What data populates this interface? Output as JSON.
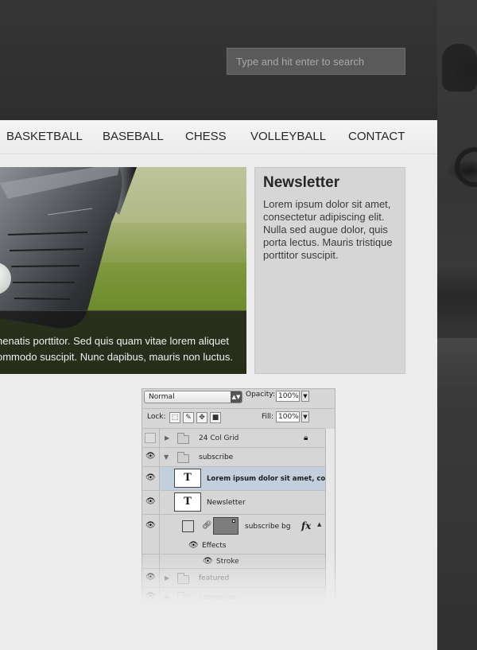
{
  "search": {
    "placeholder": "Type and hit enter to search"
  },
  "nav": {
    "items": [
      {
        "label": "BASKETBALL"
      },
      {
        "label": "BASEBALL"
      },
      {
        "label": "CHESS"
      },
      {
        "label": "VOLLEYBALL"
      },
      {
        "label": "CONTACT"
      }
    ]
  },
  "hero": {
    "caption_line1": "nenatis porttitor. Sed quis quam vitae lorem aliquet",
    "caption_line2": "ommodo suscipit. Nunc dapibus, mauris non luctus."
  },
  "newsletter": {
    "title": "Newsletter",
    "body": "Lorem ipsum dolor sit amet, consectetur adipiscing elit. Nulla sed augue dolor, quis porta lectus. Mauris tristique porttitor suscipit."
  },
  "layers_panel": {
    "blend_mode": "Normal",
    "opacity_label": "Opacity:",
    "opacity_value": "100%",
    "lock_label": "Lock:",
    "fill_label": "Fill:",
    "fill_value": "100%",
    "layers": [
      {
        "name": "24 Col Grid",
        "kind": "group",
        "visible": false,
        "locked": true
      },
      {
        "name": "subscribe",
        "kind": "group",
        "visible": true,
        "expanded": true
      },
      {
        "name": "Lorem ipsum dolor sit amet, con...",
        "kind": "text",
        "visible": true,
        "selected": true
      },
      {
        "name": "Newsletter",
        "kind": "text",
        "visible": true
      },
      {
        "name": "subscribe bg",
        "kind": "shape",
        "visible": true,
        "fx": "fx"
      },
      {
        "name": "Effects",
        "kind": "effects"
      },
      {
        "name": "Stroke",
        "kind": "effect"
      },
      {
        "name": "featured",
        "kind": "group",
        "visible": true
      },
      {
        "name": "categories",
        "kind": "group",
        "visible": true
      }
    ]
  },
  "colors": {
    "header_bg": "#2f2f2f",
    "page_bg": "#ececec",
    "newsletter_bg": "#d6d6d6",
    "selected_layer": "#c3cfdd"
  },
  "icons": [
    "eye-icon",
    "folder-icon",
    "lock-icon",
    "link-icon",
    "fx-icon",
    "text-layer-icon",
    "move-icon",
    "brush-icon"
  ]
}
